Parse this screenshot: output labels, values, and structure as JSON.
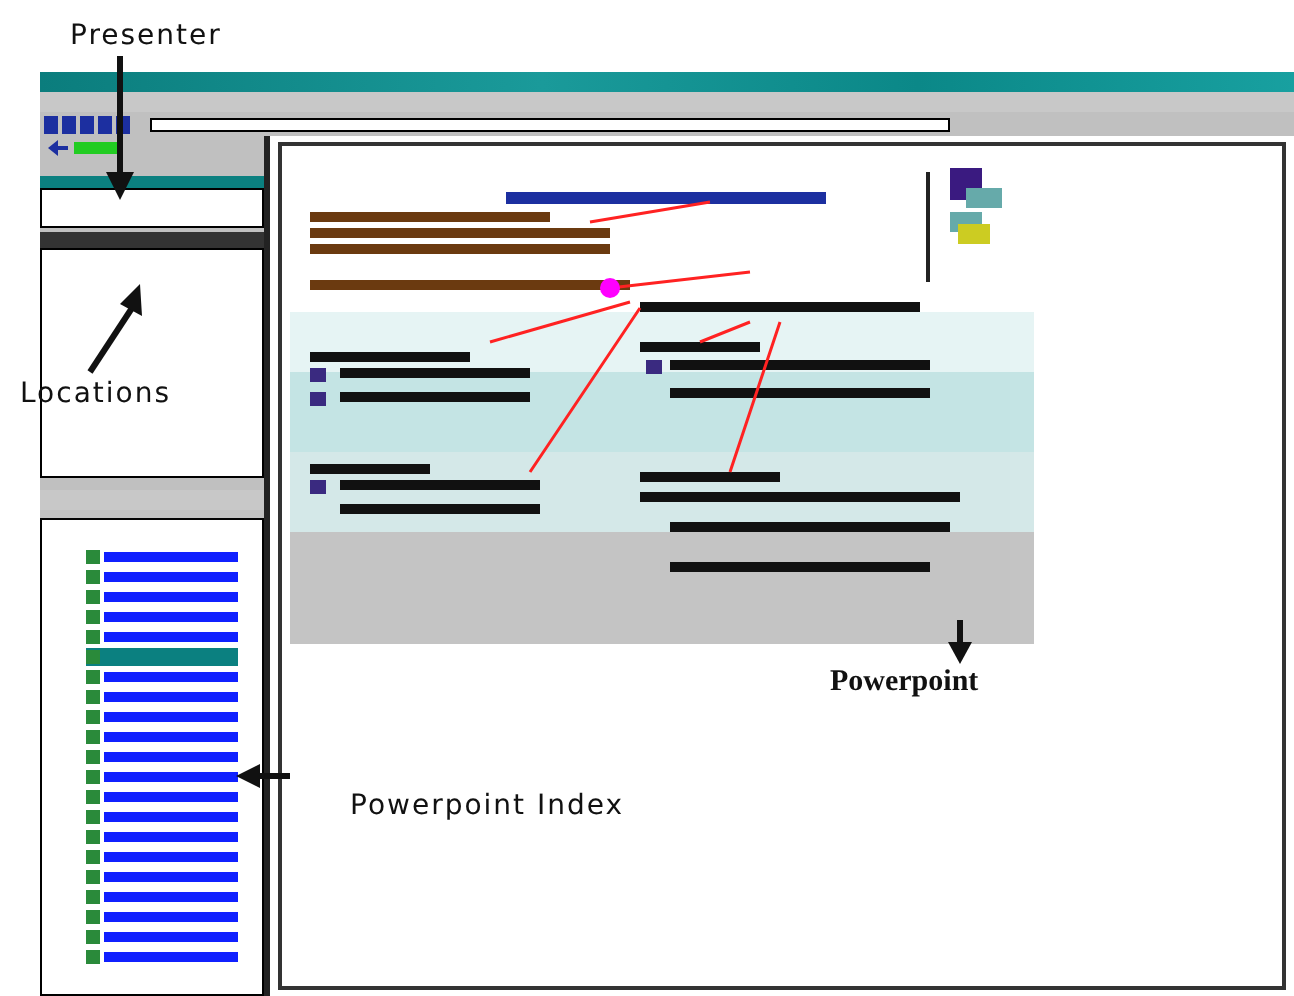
{
  "annotations": [
    {
      "label": "Presenter"
    },
    {
      "label": "Locations"
    },
    {
      "label": "Powerpoint"
    },
    {
      "label": "Powerpoint Index"
    }
  ],
  "index_rows": [
    {
      "selected": false
    },
    {
      "selected": false
    },
    {
      "selected": false
    },
    {
      "selected": false
    },
    {
      "selected": false
    },
    {
      "selected": true
    },
    {
      "selected": false
    },
    {
      "selected": false
    },
    {
      "selected": false
    },
    {
      "selected": false
    },
    {
      "selected": false
    },
    {
      "selected": false
    },
    {
      "selected": false
    },
    {
      "selected": false
    },
    {
      "selected": false
    },
    {
      "selected": false
    },
    {
      "selected": false
    },
    {
      "selected": false
    },
    {
      "selected": false
    },
    {
      "selected": false
    },
    {
      "selected": false
    }
  ]
}
